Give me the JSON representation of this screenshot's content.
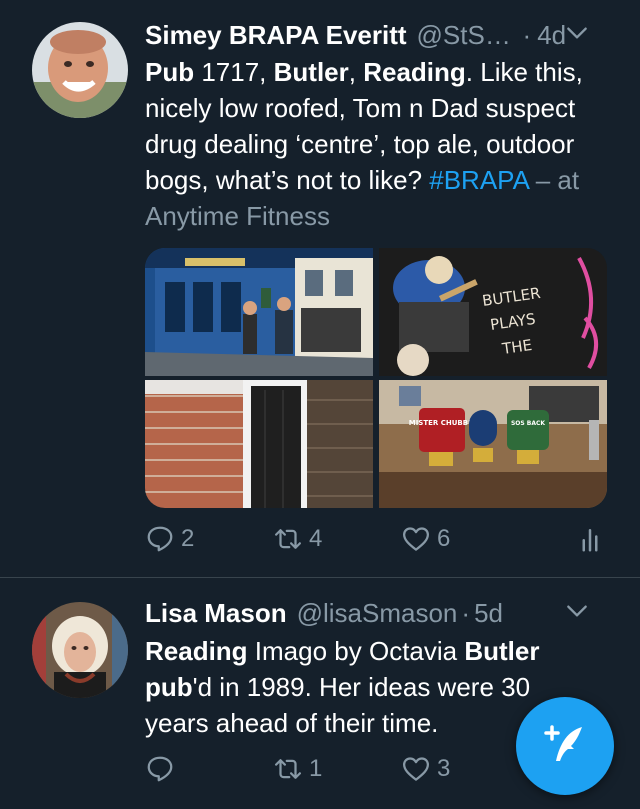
{
  "tweets": [
    {
      "name": "Simey BRAPA Everitt",
      "handle": "@StSimey",
      "dot": "·",
      "time": "4d",
      "text": {
        "w1": "Pub",
        "t1": " 1717, ",
        "w2": "Butler",
        "t2": ", ",
        "w3": "Reading",
        "t3": ".  Like this, nicely low roofed, Tom n Dad suspect drug dealing ‘centre’, top ale, outdoor bogs, what’s not to like? ",
        "hashtag": "#BRAPA",
        "location": " – at Anytime Fitness"
      },
      "photos": [
        "pub-exterior-photo",
        "mural-photo",
        "brick-doorway-photo",
        "bar-pumps-photo"
      ],
      "mural_text": [
        "BUTLER",
        "PLAYS",
        "THE"
      ],
      "pump_labels": [
        "MISTER CHUBB'S",
        "SOS BACK"
      ],
      "reply_count": "2",
      "retweet_count": "4",
      "like_count": "6"
    },
    {
      "name": "Lisa Mason",
      "handle": "@lisaSmason",
      "dot": "·",
      "time": "5d",
      "text": {
        "w1": "Reading",
        "t1": " Imago by Octavia ",
        "w2": "Butler",
        "t2": " ",
        "w3": "pub",
        "t3": "'d in 1989. Her ideas were 30 years ahead of their time."
      },
      "reply_count": "",
      "retweet_count": "1",
      "like_count": "3"
    }
  ],
  "colors": {
    "background": "#15202b",
    "accent": "#1da1f2",
    "muted": "#8899a6",
    "divider": "#38444d"
  },
  "icons": [
    "reply-icon",
    "retweet-icon",
    "like-icon",
    "analytics-icon",
    "chevron-down-icon",
    "compose-tweet-icon"
  ]
}
